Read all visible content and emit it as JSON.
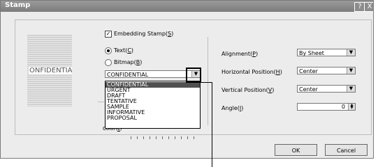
{
  "window": {
    "title": "Stamp",
    "help_button": "?",
    "close_button": "X"
  },
  "preview": {
    "stamp_text": "ONFIDENTIA"
  },
  "embedding_stamp": {
    "label": "Embedding Stamp(",
    "key": "S",
    "close": ")",
    "checked": true,
    "check_glyph": "✓"
  },
  "source": {
    "text_label": "Text(",
    "text_key": "C",
    "bitmap_label": "Bitmap(",
    "bitmap_key": "B",
    "close": ")",
    "selected": "text"
  },
  "stamp_text_combo": {
    "value": "CONFIDENTIAL",
    "arrow": "▼",
    "options": [
      "CONFIDENTIAL",
      "URGENT",
      "DRAFT",
      "TENTATIVE",
      "SAMPLE",
      "INFORMATIVE",
      "PROPOSAL"
    ],
    "selected_index": 0
  },
  "color": {
    "label": "Color(",
    "key": "L",
    "close": ")"
  },
  "alignment": {
    "label": "Alignment(",
    "key": "P",
    "close": ")",
    "value": "By Sheet",
    "arrow": "▼"
  },
  "horizontal_position": {
    "label": "Horizontal Position(",
    "key": "H",
    "close": ")",
    "value": "Center",
    "arrow": "▼"
  },
  "vertical_position": {
    "label": "Vertical Position(",
    "key": "V",
    "close": ")",
    "value": "Center",
    "arrow": "▼"
  },
  "angle": {
    "label": "Angle(",
    "key": "I",
    "close": ")",
    "value": "0",
    "up": "▲",
    "down": "▼"
  },
  "buttons": {
    "ok": "OK",
    "cancel": "Cancel"
  }
}
